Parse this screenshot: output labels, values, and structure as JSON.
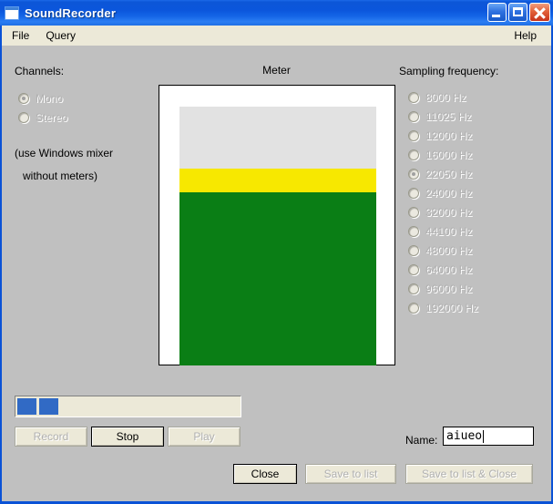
{
  "window": {
    "title": "SoundRecorder",
    "icon": "app-window-icon",
    "buttons": {
      "minimize": "minimize-icon",
      "maximize": "maximize-icon",
      "close": "close-icon"
    }
  },
  "menu": {
    "items": [
      "File",
      "Query"
    ],
    "help": "Help"
  },
  "channels": {
    "heading": "Channels:",
    "options": [
      {
        "label": "Mono",
        "selected": true,
        "disabled": true
      },
      {
        "label": "Stereo",
        "selected": false,
        "disabled": true
      }
    ],
    "note_line1": "(use Windows mixer",
    "note_line2": "without meters)"
  },
  "meter": {
    "title": "Meter",
    "segments": [
      {
        "name": "headroom",
        "color": "#e2e2e2"
      },
      {
        "name": "warning",
        "color": "#f7e800"
      },
      {
        "name": "level",
        "color": "#0a7e15"
      }
    ]
  },
  "sampling": {
    "heading": "Sampling frequency:",
    "options": [
      {
        "label": "8000 Hz",
        "selected": false,
        "disabled": true
      },
      {
        "label": "11025 Hz",
        "selected": false,
        "disabled": true
      },
      {
        "label": "12000 Hz",
        "selected": false,
        "disabled": true
      },
      {
        "label": "16000 Hz",
        "selected": false,
        "disabled": true
      },
      {
        "label": "22050 Hz",
        "selected": true,
        "disabled": true
      },
      {
        "label": "24000 Hz",
        "selected": false,
        "disabled": true
      },
      {
        "label": "32000 Hz",
        "selected": false,
        "disabled": true
      },
      {
        "label": "44100 Hz",
        "selected": false,
        "disabled": true
      },
      {
        "label": "48000 Hz",
        "selected": false,
        "disabled": true
      },
      {
        "label": "64000 Hz",
        "selected": false,
        "disabled": true
      },
      {
        "label": "96000 Hz",
        "selected": false,
        "disabled": true
      },
      {
        "label": "192000 Hz",
        "selected": false,
        "disabled": true
      }
    ]
  },
  "progress": {
    "chunks": 2,
    "chunk_color": "#316ac5"
  },
  "transport": {
    "record": {
      "label": "Record",
      "disabled": true
    },
    "stop": {
      "label": "Stop",
      "disabled": false
    },
    "play": {
      "label": "Play",
      "disabled": true
    }
  },
  "name_field": {
    "label": "Name:",
    "value": "aiueo",
    "placeholder": ""
  },
  "footer": {
    "close": {
      "label": "Close",
      "disabled": false
    },
    "save_to_list": {
      "label": "Save to list",
      "disabled": true
    },
    "save_to_list_and_close": {
      "label": "Save to list & Close",
      "disabled": true
    }
  }
}
